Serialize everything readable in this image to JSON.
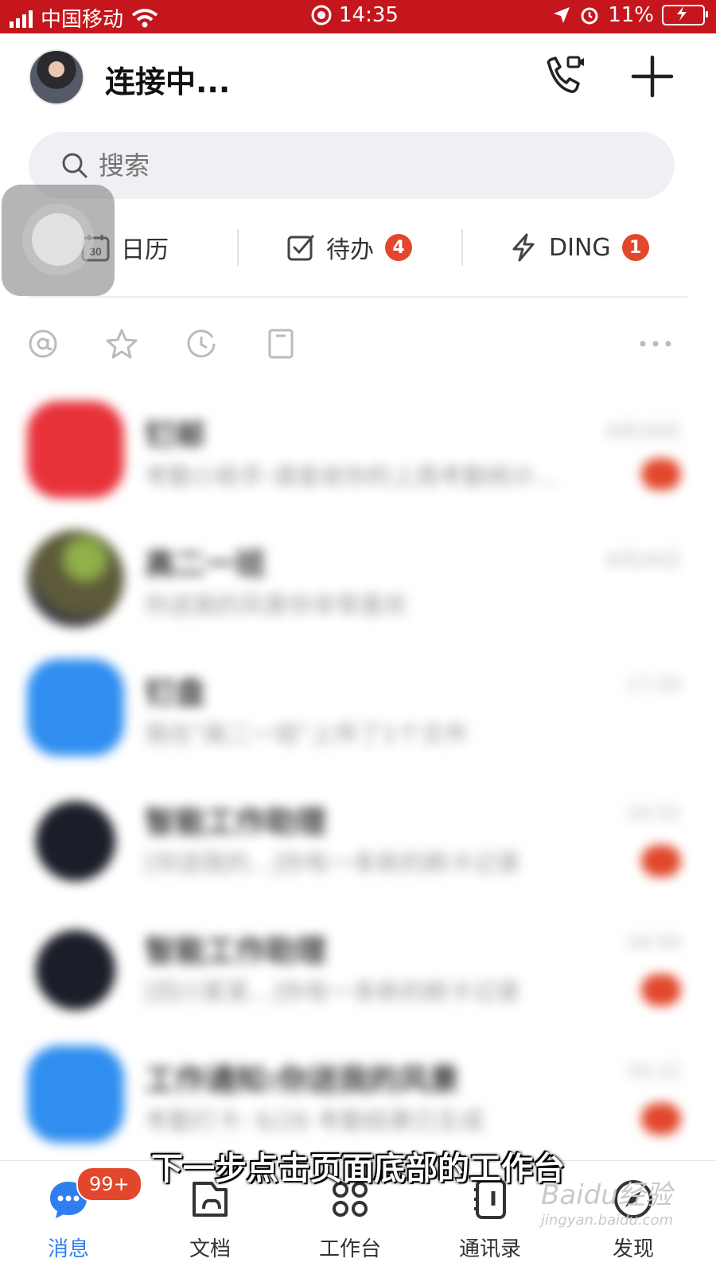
{
  "status_bar": {
    "carrier": "中国移动",
    "time": "14:35",
    "battery": "11%"
  },
  "header": {
    "title": "连接中..."
  },
  "search": {
    "placeholder": "搜索"
  },
  "shortcuts": [
    {
      "label": "日历",
      "icon": "calendar-icon",
      "icon_text": "30"
    },
    {
      "label": "待办",
      "icon": "todo-check-icon",
      "badge": "4"
    },
    {
      "label": "DING",
      "icon": "lightning-icon",
      "badge": "1"
    }
  ],
  "filters": [
    "at-icon",
    "star-icon",
    "clock-icon",
    "bookmark-icon",
    "more-icon"
  ],
  "chats": [
    {
      "name": "钉邮",
      "preview": "考勤小助手:请查收你的上周考勤统计...",
      "time": "6月26日",
      "badge": true,
      "avatar": "red"
    },
    {
      "name": "高二一班",
      "preview": "你送我的风景你非常喜欢",
      "time": "6月26日",
      "badge": false,
      "avatar": "photo"
    },
    {
      "name": "钉盘",
      "preview": "我在\"高二一班\"上传了1个文件",
      "time": "17:20",
      "badge": false,
      "avatar": "blue"
    },
    {
      "name": "智能工作助理",
      "preview": "[你送我的...]你有一条新的刷卡记录",
      "time": "16:52",
      "badge": true,
      "avatar": "robot"
    },
    {
      "name": "智能工作助理",
      "preview": "[四川某某...]你有一条新的刷卡记录",
      "time": "16:50",
      "badge": true,
      "avatar": "robot"
    },
    {
      "name": "工作通知:你送我的风景",
      "preview": "考勤打卡: 6/26 考勤结果已生成",
      "time": "16:22",
      "badge": true,
      "avatar": "blue"
    }
  ],
  "caption": "下一步点击页面底部的工作台",
  "tabbar": {
    "badge": "99+",
    "tabs": [
      {
        "label": "消息",
        "icon": "message-icon",
        "active": true
      },
      {
        "label": "文档",
        "icon": "document-icon",
        "active": false
      },
      {
        "label": "工作台",
        "icon": "workbench-icon",
        "active": false
      },
      {
        "label": "通讯录",
        "icon": "contacts-icon",
        "active": false
      },
      {
        "label": "发现",
        "icon": "compass-icon",
        "active": false
      }
    ]
  },
  "watermark": {
    "brand": "Baidu经验",
    "url": "jingyan.baidu.com"
  },
  "colors": {
    "accent": "#2f7ef0",
    "status_bar": "#c4161c",
    "badge": "#e2472b"
  }
}
